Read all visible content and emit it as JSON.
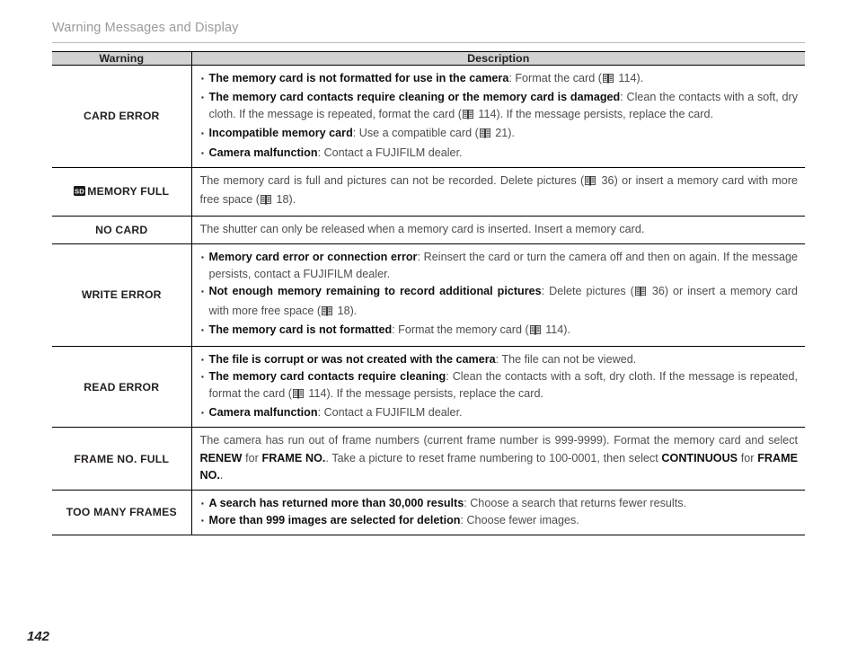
{
  "header": {
    "running_title": "Warning Messages and Display"
  },
  "folio": {
    "page_number": "142"
  },
  "icons": {
    "sd": "sd-card-icon",
    "book": "manual-reference-icon"
  },
  "table": {
    "columns": [
      {
        "label": "Warning"
      },
      {
        "label": "Description"
      }
    ],
    "rows": [
      {
        "warning": "CARD ERROR",
        "warning_icon": null,
        "type": "bullets",
        "items": [
          {
            "bold": "The memory card is not formatted for use in the camera",
            "rest": ": Format the card (",
            "ref": "114",
            "tail": ")."
          },
          {
            "bold": "The memory card contacts require cleaning or the memory card is damaged",
            "rest": ": Clean the contacts with a soft, dry cloth.  If the message is repeated, format the card (",
            "ref": "114",
            "tail": ").  If the message persists, replace the card."
          },
          {
            "bold": "Incompatible memory card",
            "rest": ": Use a compatible card (",
            "ref": "21",
            "tail": ")."
          },
          {
            "bold": "Camera malfunction",
            "rest": ": Contact a FUJIFILM dealer.",
            "ref": null,
            "tail": ""
          }
        ]
      },
      {
        "warning": "MEMORY FULL",
        "warning_icon": "sd",
        "type": "paragraph",
        "paragraph": {
          "a": "The memory card is full and pictures can not be recorded.  Delete pictures (",
          "ref1": "36",
          "b": ") or insert a memory card with more free space (",
          "ref2": "18",
          "c": ")."
        }
      },
      {
        "warning": "NO CARD",
        "warning_icon": null,
        "type": "plain",
        "text": "The shutter can only be released when a memory card is inserted.  Insert a memory card."
      },
      {
        "warning": "WRITE ERROR",
        "warning_icon": null,
        "type": "bullets",
        "items": [
          {
            "bold": "Memory card error or connection error",
            "rest": ": Reinsert the card or turn the camera off and then on again.  If the message persists, contact a FUJIFILM dealer.",
            "ref": null,
            "tail": ""
          },
          {
            "bold": "Not enough memory remaining to record additional pictures",
            "rest": ": Delete pictures (",
            "ref": "36",
            "tail": ") or insert a memory card with more free space (",
            "ref2": "18",
            "tail2": ")."
          },
          {
            "bold": "The memory card is not formatted",
            "rest": ": Format the memory card (",
            "ref": "114",
            "tail": ")."
          }
        ]
      },
      {
        "warning": "READ ERROR",
        "warning_icon": null,
        "type": "bullets",
        "items": [
          {
            "bold": "The file is corrupt or was not created with the camera",
            "rest": ": The file can not be viewed.",
            "ref": null,
            "tail": ""
          },
          {
            "bold": "The memory card contacts require cleaning",
            "rest": ": Clean the contacts with a soft, dry cloth.  If the message is repeated, format the card (",
            "ref": "114",
            "tail": ").  If the message persists, replace the card."
          },
          {
            "bold": "Camera malfunction",
            "rest": ": Contact a FUJIFILM dealer.",
            "ref": null,
            "tail": ""
          }
        ]
      },
      {
        "warning": "FRAME NO. FULL",
        "warning_icon": null,
        "type": "rich",
        "rich": {
          "p1": "The camera has run out of frame numbers (current frame number is 999-9999).  Format the memory card and select ",
          "b1": "RENEW",
          "p2": " for ",
          "b2": "FRAME NO.",
          "p3": ".  Take a picture to reset frame numbering to 100-0001, then select ",
          "b3": "CONTINUOUS",
          "p4": " for ",
          "b4": "FRAME NO.",
          "p5": "."
        }
      },
      {
        "warning": "TOO MANY FRAMES",
        "warning_icon": null,
        "type": "bullets",
        "items": [
          {
            "bold": "A search has returned more than 30,000 results",
            "rest": ": Choose a search that returns fewer results.",
            "ref": null,
            "tail": ""
          },
          {
            "bold": "More than 999 images are selected for deletion",
            "rest": ": Choose fewer images.",
            "ref": null,
            "tail": ""
          }
        ]
      }
    ]
  }
}
